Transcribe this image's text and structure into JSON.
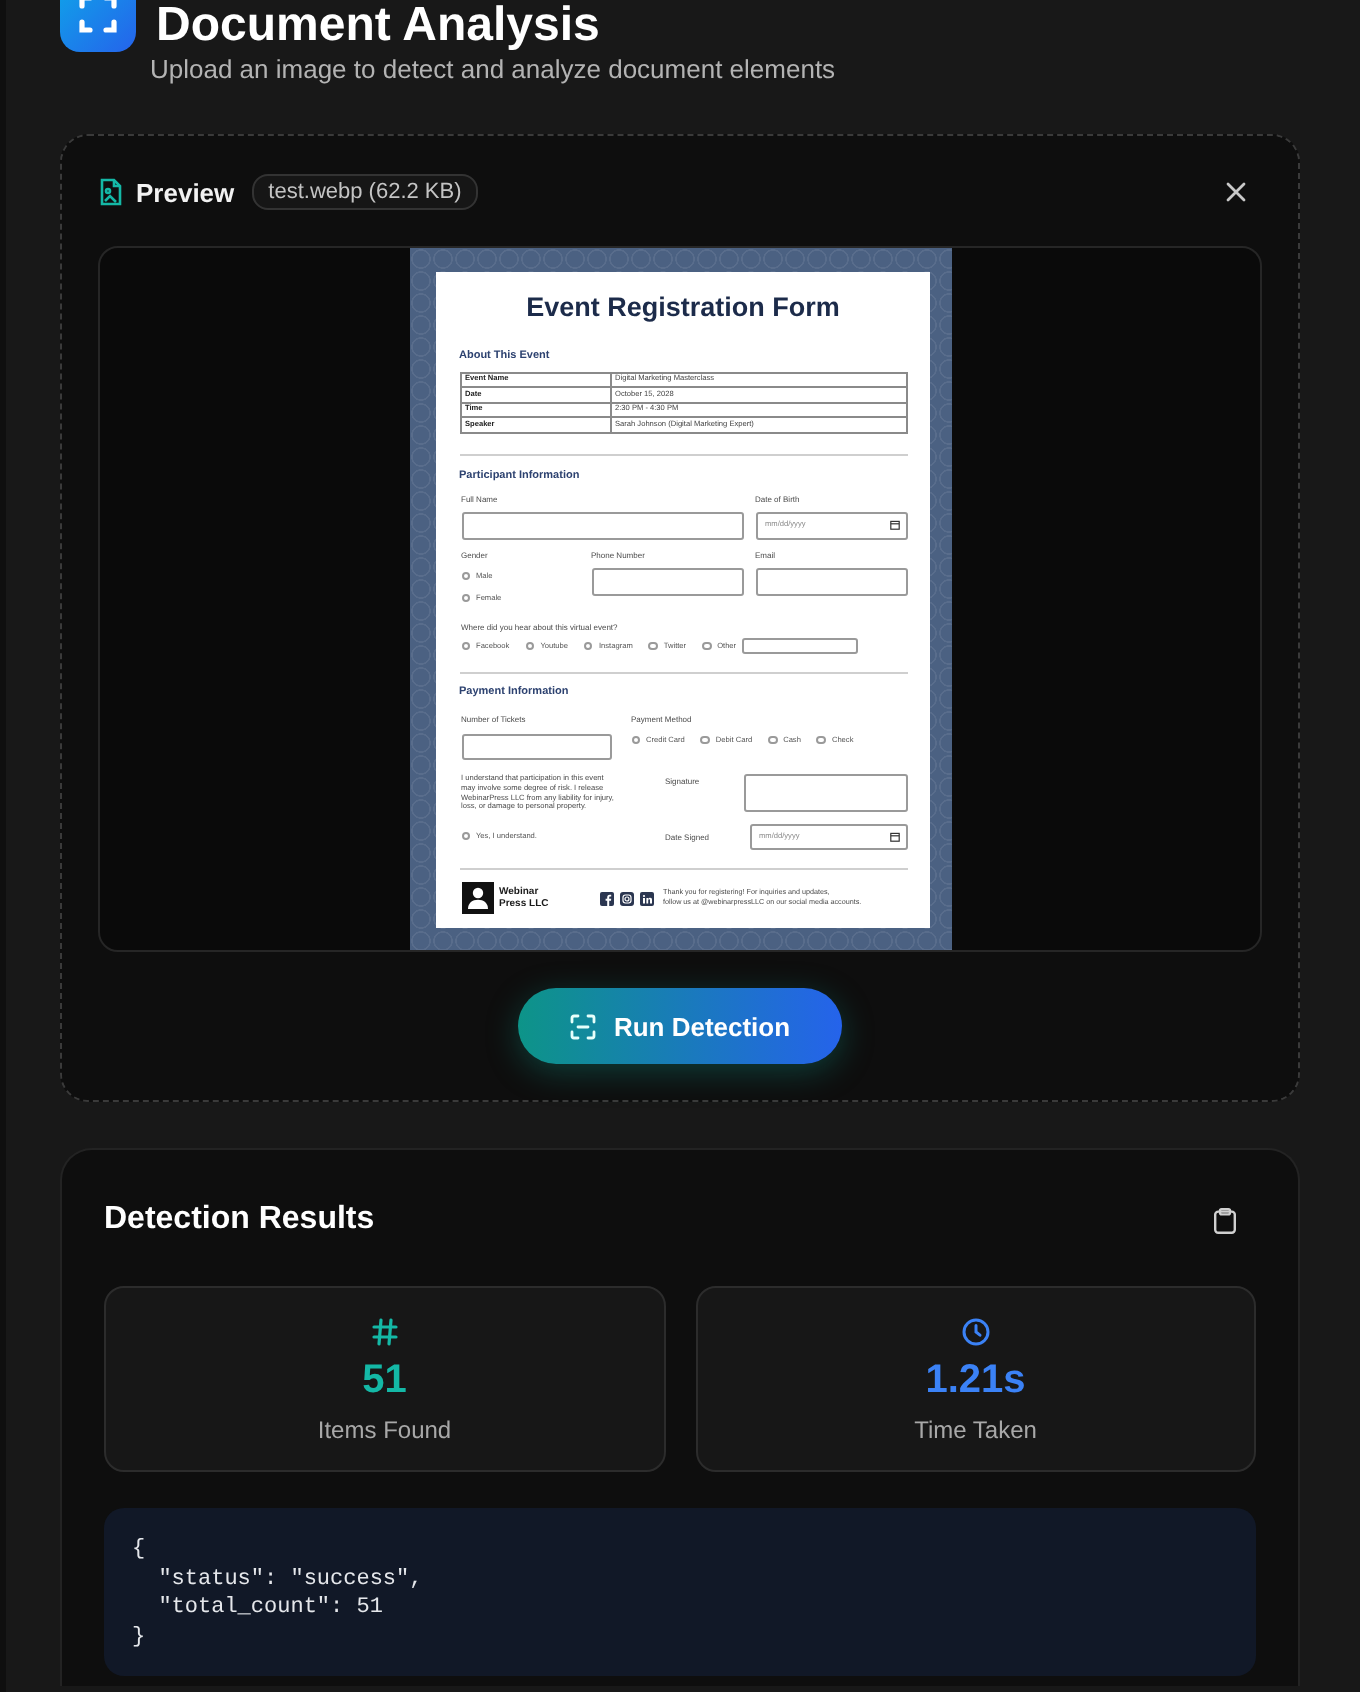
{
  "header": {
    "title": "Document Analysis",
    "subtitle": "Upload an image to detect and analyze document elements"
  },
  "preview": {
    "label": "Preview",
    "file": "test.webp (62.2 KB)",
    "document": {
      "title": "Event Registration Form",
      "event": {
        "heading": "About This Event",
        "rows": [
          {
            "label": "Event Name",
            "value": "Digital Marketing Masterclass"
          },
          {
            "label": "Date",
            "value": "October 15, 2028"
          },
          {
            "label": "Time",
            "value": "2:30 PM - 4:30 PM"
          },
          {
            "label": "Speaker",
            "value": "Sarah Johnson (Digital Marketing Expert)"
          }
        ]
      },
      "participant": {
        "heading": "Participant Information",
        "full_name": {
          "label": "Full Name"
        },
        "date_of_birth": {
          "label": "Date of Birth",
          "placeholder": "mm/dd/yyyy"
        },
        "gender": {
          "label": "Gender",
          "options": [
            {
              "label": "Male",
              "selected": false
            },
            {
              "label": "Female",
              "selected": false
            }
          ]
        },
        "phone": {
          "label": "Phone Number"
        },
        "email": {
          "label": "Email"
        },
        "source": {
          "label": "Where did you hear about this virtual event?",
          "options": [
            {
              "label": "Facebook",
              "selected": false
            },
            {
              "label": "Youtube",
              "selected": false
            },
            {
              "label": "Instagram",
              "selected": false
            },
            {
              "label": "Twitter",
              "selected": false
            },
            {
              "label": "Other",
              "selected": false
            }
          ]
        }
      },
      "payment": {
        "heading": "Payment Information",
        "tickets": {
          "label": "Number of Tickets"
        },
        "method": {
          "label": "Payment Method",
          "options": [
            {
              "label": "Credit Card",
              "selected": false
            },
            {
              "label": "Debit Card",
              "selected": false
            },
            {
              "label": "Cash",
              "selected": false
            },
            {
              "label": "Check",
              "selected": false
            }
          ]
        },
        "waiver": "I understand that participation in this event\nmay involve some degree of risk. I release\nWebinarPress LLC from any liability for injury,\nloss, or damage to personal property.",
        "consent": {
          "label": "Yes, I understand.",
          "selected": false
        },
        "signature": {
          "label": "Signature"
        },
        "date_signed": {
          "label": "Date Signed",
          "placeholder": "mm/dd/yyyy"
        }
      },
      "footer": {
        "company": "Webinar Press LLC",
        "note": "Thank you for registering! For inquiries and updates,\nfollow us at @webinarpressLLC on our social media accounts."
      }
    }
  },
  "run_button": {
    "label": "Run Detection"
  },
  "results": {
    "title": "Detection Results",
    "stats": [
      {
        "kind": "count",
        "value": "51",
        "label": "Items Found",
        "color": "#14b8a6"
      },
      {
        "kind": "time",
        "value": "1.21s",
        "label": "Time Taken",
        "color": "#3b82f6"
      }
    ],
    "code": "{\n  \"status\": \"success\",\n  \"total_count\": 51\n}"
  }
}
